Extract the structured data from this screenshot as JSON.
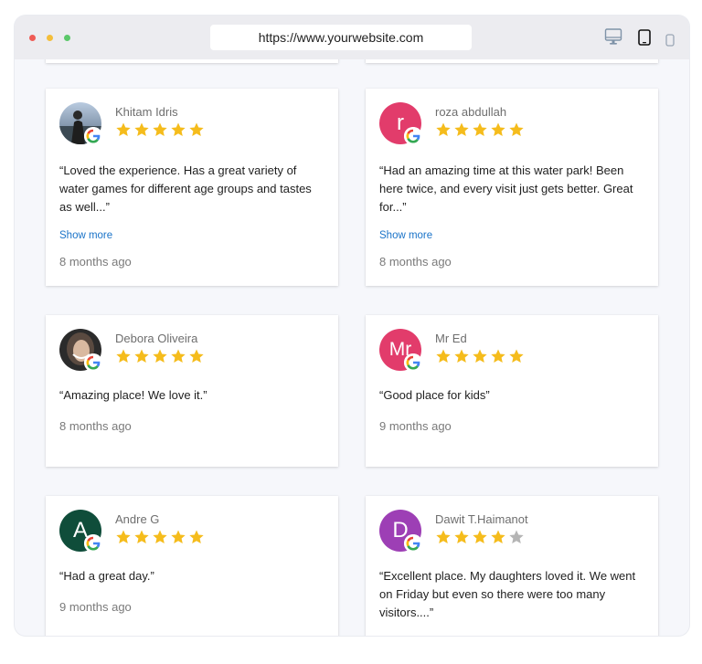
{
  "browser": {
    "url": "https://www.yourwebsite.com"
  },
  "reviews": [
    {
      "name": "Khitam Idris",
      "avatar_type": "photo-landscape",
      "rating": 5,
      "text": "“Loved the experience. Has a great variety of water games for different age groups and tastes as well...”",
      "show_more": "Show more",
      "time": "8 months ago"
    },
    {
      "name": "roza abdullah",
      "avatar_letter": "r",
      "avatar_color": "#e23c6b",
      "rating": 5,
      "text": "“Had an amazing time at this water park! Been here twice, and every visit just gets better. Great for...”",
      "show_more": "Show more",
      "time": "8 months ago"
    },
    {
      "name": "Debora Oliveira",
      "avatar_type": "photo-portrait",
      "rating": 5,
      "text": "“Amazing place! We love it.”",
      "time": "8 months ago"
    },
    {
      "name": "Mr Ed",
      "avatar_letter": "Mr",
      "avatar_color": "#e23c6b",
      "rating": 5,
      "text": "“Good place for kids”",
      "time": "9 months ago"
    },
    {
      "name": "Andre G",
      "avatar_letter": "A",
      "avatar_color": "#0f4d3a",
      "rating": 5,
      "text": "“Had a great day.”",
      "time": "9 months ago"
    },
    {
      "name": "Dawit T.Haimanot",
      "avatar_letter": "D",
      "avatar_color": "#9d3fb5",
      "rating": 4,
      "text": "“Excellent place. My daughters loved it. We went on Friday but even so there were too many visitors....”"
    }
  ],
  "colors": {
    "star_filled": "#f5bc1c",
    "star_empty": "#b5b5b5",
    "link": "#1a73c8"
  },
  "icons": [
    "desktop-icon",
    "tablet-icon",
    "mobile-icon",
    "google-icon",
    "star-icon"
  ]
}
